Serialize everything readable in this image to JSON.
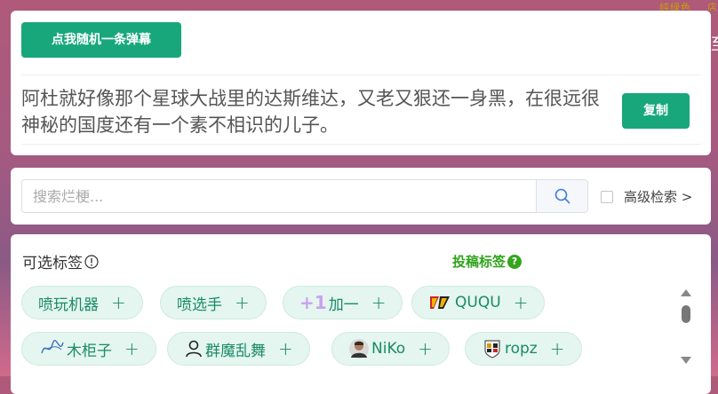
{
  "top_right": {
    "text1": "纯绿色",
    "text2": "店"
  },
  "edge_char": "至",
  "danmu": {
    "random_button": "点我随机一条弹幕",
    "text": "阿杜就好像那个星球大战里的达斯维达，又老又狠还一身黑，在很远很神秘的国度还有一个素不相识的儿子。",
    "copy_button": "复制"
  },
  "search": {
    "placeholder": "搜索烂梗...",
    "value": "",
    "advanced_label": "高级检索 >"
  },
  "tags": {
    "title": "可选标签",
    "submit_label": "投稿标签",
    "submit_help": "?",
    "items": [
      {
        "label": "喷玩机器",
        "icon": "none"
      },
      {
        "label": "喷选手",
        "icon": "none"
      },
      {
        "label": "加一",
        "prefix": "+1",
        "icon": "plus-one"
      },
      {
        "label": "QUQU",
        "icon": "team-logo"
      },
      {
        "label": "木柜子",
        "icon": "signature-logo"
      },
      {
        "label": "群魔乱舞",
        "icon": "person-outline"
      },
      {
        "label": "NiKo",
        "icon": "player-avatar"
      },
      {
        "label": "ropz",
        "icon": "team-crest"
      }
    ],
    "plus_symbol": "+"
  },
  "colors": {
    "accent": "#18a77a",
    "tag_bg": "#e4f6ef",
    "submit_green": "#2ea31a"
  }
}
